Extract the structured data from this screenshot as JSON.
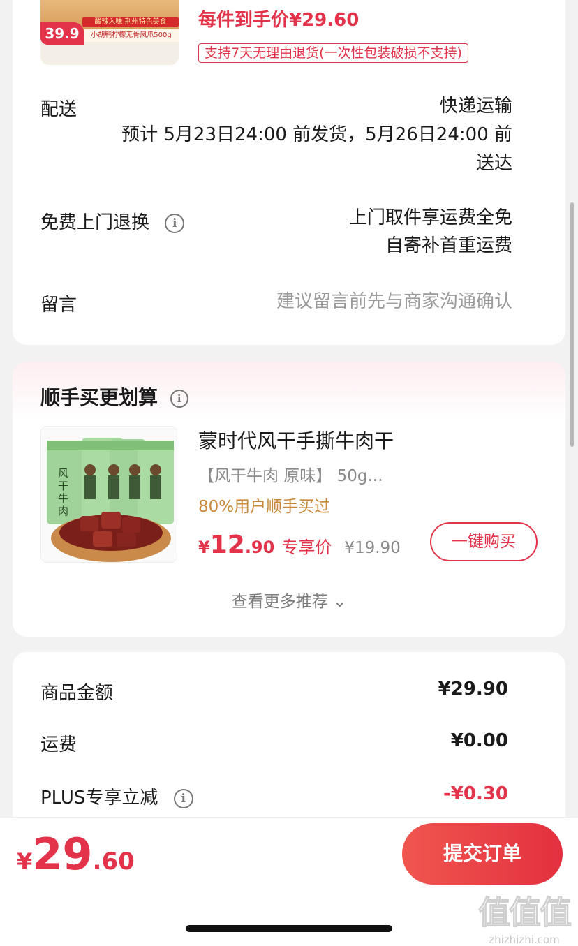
{
  "product": {
    "badge_top": "酸辣入味 荆州特色美食",
    "thumb_price": "39.9",
    "thumb_caption": "小胡鸭柠檬无骨凤爪500g",
    "unit_price": "每件到手价¥29.60",
    "return_policy": "支持7天无理由退货(一次性包装破损不支持)"
  },
  "delivery": {
    "label": "配送",
    "method": "快递运输",
    "eta_line1": "预计 5月23日24:00 前发货，5月26日24:00 前",
    "eta_line2": "送达"
  },
  "free_return": {
    "label": "免费上门退换",
    "line1": "上门取件享运费全免",
    "line2": "自寄补首重运费"
  },
  "message": {
    "label": "留言",
    "placeholder": "建议留言前先与商家沟通确认"
  },
  "bundle": {
    "title": "顺手买更划算",
    "item_name": "蒙时代风干手撕牛肉干",
    "item_spec": "【风干牛肉 原味】 50g...",
    "social_proof": "80%用户顺手买过",
    "price_symbol": "¥",
    "price_int": "12",
    "price_dec": ".90",
    "price_tag": "专享价",
    "original_price": "¥19.90",
    "buy_label": "一键购买",
    "more_label": "查看更多推荐 ⌄",
    "thumb_text": "风干牛肉"
  },
  "summary": {
    "rows": [
      {
        "label": "商品金额",
        "value": "¥29.90"
      },
      {
        "label": "运费",
        "value": "¥0.00"
      },
      {
        "label": "PLUS专享立减",
        "value": "-¥0.30"
      }
    ]
  },
  "footer": {
    "total_symbol": "¥",
    "total_int": "29",
    "total_dec": ".60",
    "submit_label": "提交订单"
  },
  "watermark": {
    "glyphs": "值值值",
    "site": "zhizhizhi.com"
  },
  "colors": {
    "accent": "#e2334a",
    "social": "#c8893a"
  }
}
